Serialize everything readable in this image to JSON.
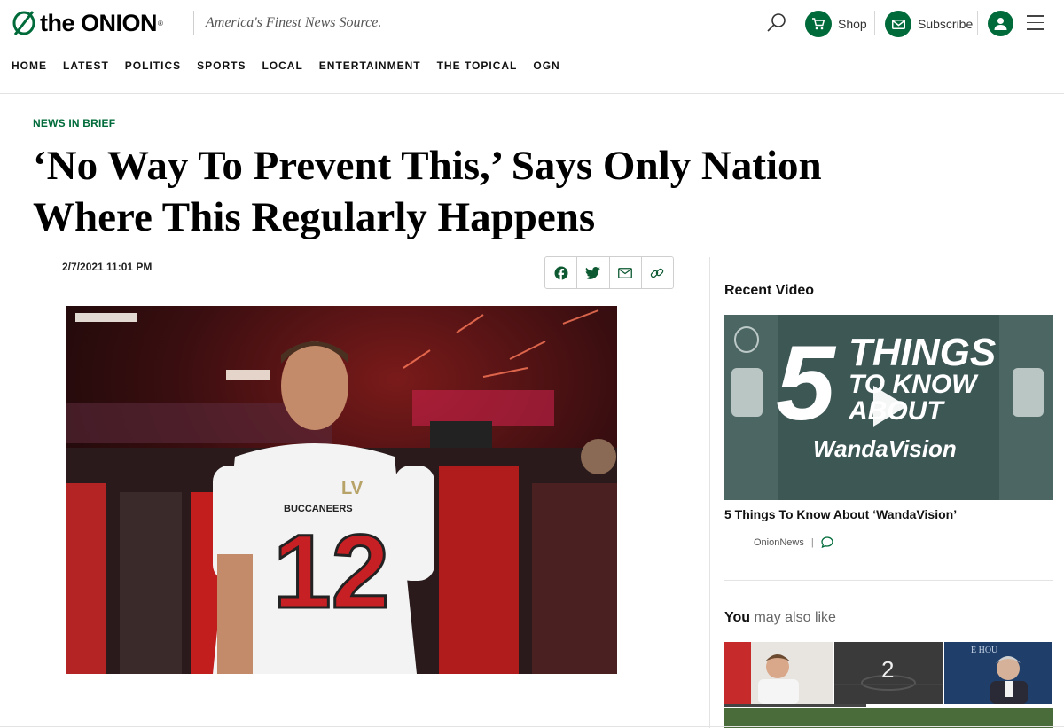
{
  "header": {
    "logo_text": "the ONION",
    "logo_reg": "®",
    "tagline": "America's Finest News Source.",
    "shop_label": "Shop",
    "subscribe_label": "Subscribe",
    "brand_color": "#006b3a"
  },
  "nav": {
    "items": [
      {
        "label": "HOME"
      },
      {
        "label": "LATEST"
      },
      {
        "label": "POLITICS"
      },
      {
        "label": "SPORTS"
      },
      {
        "label": "LOCAL"
      },
      {
        "label": "ENTERTAINMENT"
      },
      {
        "label": "THE TOPICAL"
      },
      {
        "label": "OGN"
      }
    ]
  },
  "article": {
    "kicker": "NEWS IN BRIEF",
    "headline": "‘No Way To Prevent This,’ Says Only Nation Where This Regularly Happens",
    "dateline": "2/7/2021 11:01 PM",
    "share_icons": [
      "facebook-icon",
      "twitter-icon",
      "email-icon",
      "link-icon"
    ],
    "image": {
      "jersey_team": "BUCCANEERS",
      "jersey_number": "12",
      "patch": "LV"
    }
  },
  "sidebar": {
    "recent_video_title": "Recent Video",
    "video": {
      "thumb_big_number": "5",
      "thumb_line1": "THINGS",
      "thumb_line2": "TO KNOW",
      "thumb_line3": "ABOUT",
      "thumb_line4": "WandaVision",
      "title": "5 Things To Know About ‘WandaVision’",
      "source": "OnionNews",
      "separator": "|"
    },
    "also_like_prefix": "You",
    "also_like_rest": " may also like",
    "thumbs": [
      {
        "name": "player-thumb"
      },
      {
        "name": "field-thumb",
        "text": "2"
      },
      {
        "name": "press-thumb",
        "text": "E HOU"
      }
    ]
  }
}
